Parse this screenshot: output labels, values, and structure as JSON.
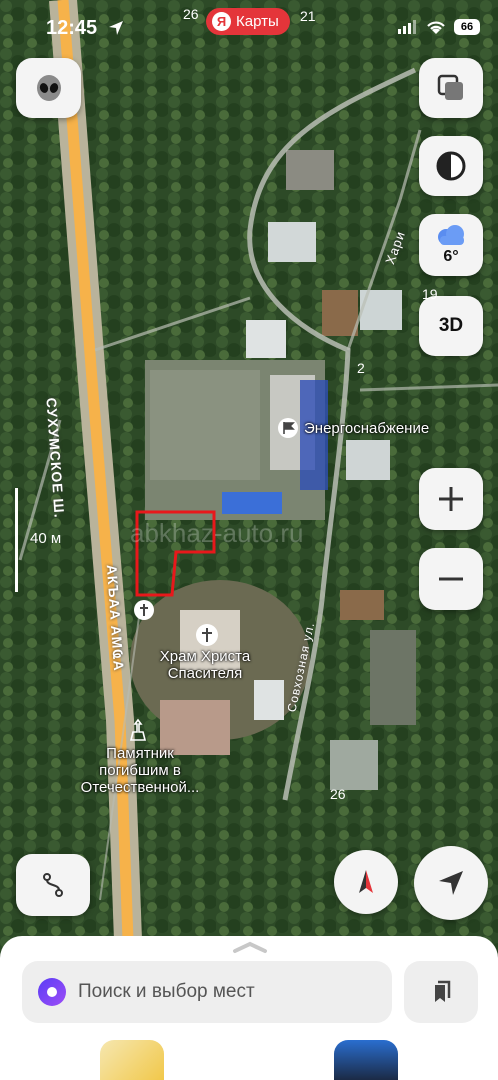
{
  "status_bar": {
    "time": "12:45",
    "app_name": "Карты",
    "app_badge": "Я",
    "battery": "66",
    "left_number": "26",
    "right_number": "21"
  },
  "map": {
    "scale_label": "40 м",
    "road_main": "СУХУМСКОЕ Ш.",
    "road_main_alt": "АКЪАА АМҨА",
    "road_side": "Совхозная ул.",
    "street_partial": "Хари",
    "watermark": "abkhaz-auto.ru",
    "house_numbers": [
      "2",
      "26",
      "19"
    ],
    "pois": {
      "energy": "Энергоснабжение",
      "temple_line1": "Храм Христа",
      "temple_line2": "Спасителя",
      "monument_line1": "Памятник",
      "monument_line2": "погибшим в",
      "monument_line3": "Отечественной..."
    }
  },
  "controls": {
    "weather_temp": "6°",
    "btn_3d": "3D",
    "zoom_in": "+",
    "zoom_out": "−"
  },
  "sheet": {
    "search_placeholder": "Поиск и выбор мест"
  },
  "icons": [
    "alien-avatar-icon",
    "layers-icon",
    "night-mode-icon",
    "cloud-icon",
    "route-icon",
    "compass-icon",
    "navigation-arrow-icon",
    "bookmark-icon",
    "alice-icon",
    "location-arrow-icon",
    "wifi-icon",
    "signal-icon",
    "flag-icon",
    "church-icon",
    "monument-icon"
  ]
}
